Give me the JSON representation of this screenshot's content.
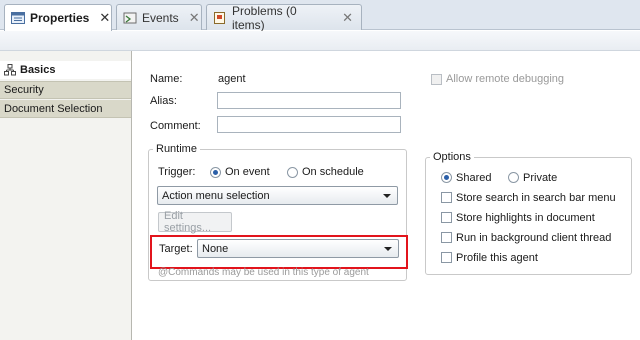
{
  "tabs": [
    {
      "label": "Properties",
      "close": "✕",
      "icon": "properties-icon"
    },
    {
      "label": "Events",
      "close": "✕",
      "icon": "events-icon"
    },
    {
      "label": "Problems (0 items)",
      "close": "✕",
      "icon": "problems-icon"
    }
  ],
  "sidebar": {
    "items": [
      {
        "label": "Basics",
        "icon": "basics-icon"
      },
      {
        "label": "Security"
      },
      {
        "label": "Document Selection"
      }
    ]
  },
  "form": {
    "name_label": "Name:",
    "name_value": "agent",
    "alias_label": "Alias:",
    "alias_value": "",
    "comment_label": "Comment:",
    "comment_value": "",
    "allow_remote_debugging": "Allow remote debugging"
  },
  "runtime": {
    "title": "Runtime",
    "trigger_label": "Trigger:",
    "on_event": "On event",
    "on_schedule": "On schedule",
    "trigger_selected": "On event",
    "event_select": "Action menu selection",
    "edit_settings": "Edit settings...",
    "target_label": "Target:",
    "target_select": "None",
    "note": "@Commands may be used in this type of agent"
  },
  "options": {
    "title": "Options",
    "shared": "Shared",
    "private": "Private",
    "scope_selected": "Shared",
    "checkboxes": [
      "Store search in search bar menu",
      "Store highlights in document",
      "Run in background client thread",
      "Profile this agent"
    ]
  },
  "colors": {
    "highlight": "#e2141c",
    "radio_accent": "#2b5fa8"
  }
}
